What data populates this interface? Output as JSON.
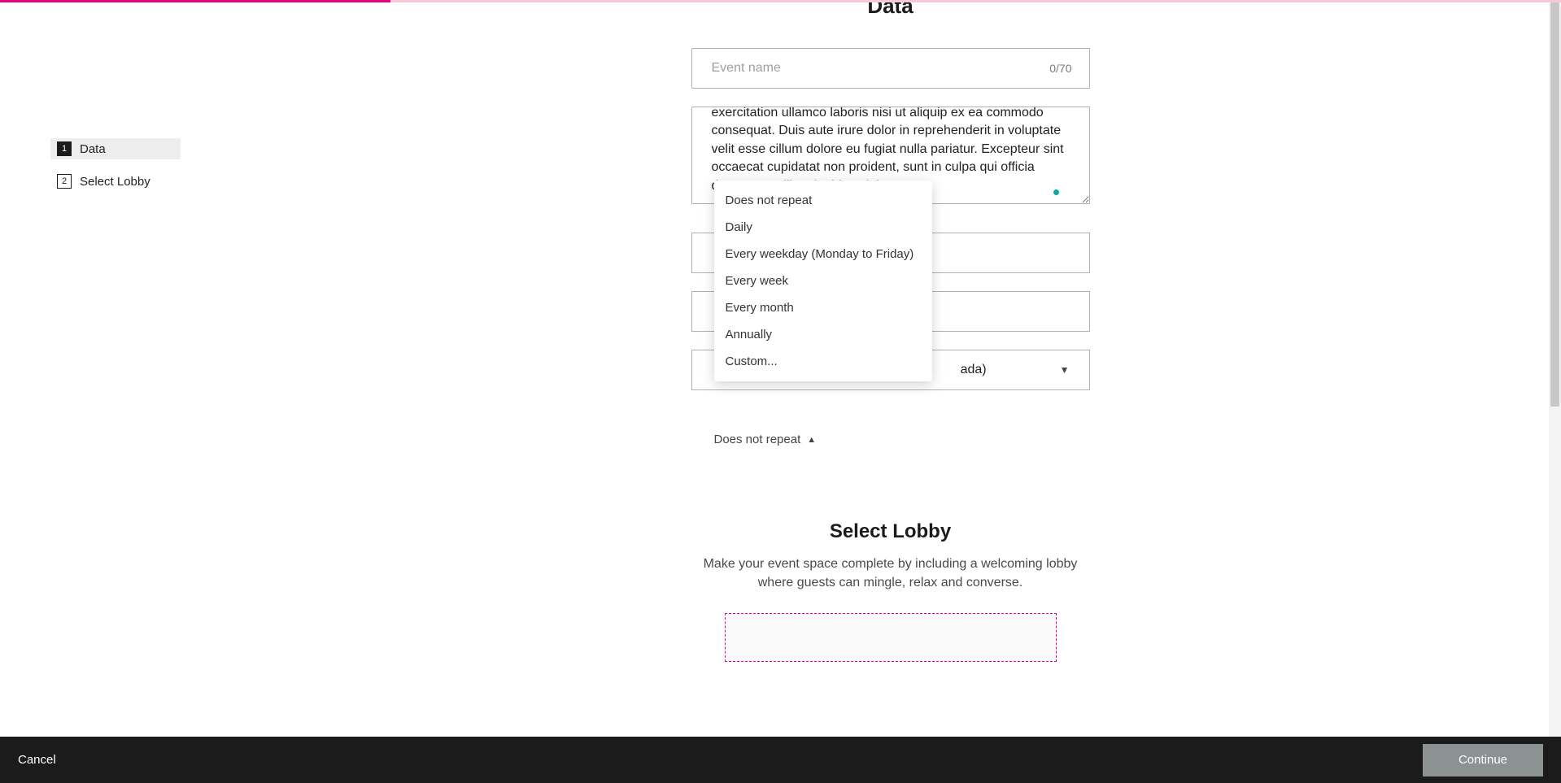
{
  "progress": {
    "percent": 25
  },
  "sidebar": {
    "steps": [
      {
        "num": "1",
        "label": "Data",
        "active": true
      },
      {
        "num": "2",
        "label": "Select Lobby",
        "active": false
      }
    ]
  },
  "form": {
    "title": "Data",
    "event_name_placeholder": "Event name",
    "event_name_value": "",
    "char_count": "0/70",
    "description_value": "exercitation ullamco laboris nisi ut aliquip ex ea commodo consequat. Duis aute irure dolor in reprehenderit in voluptate velit esse cillum dolore eu fugiat nulla pariatur. Excepteur sint occaecat cupidatat non proident, sunt in culpa qui officia deserunt mollit anim id est laborum.",
    "field_hidden_1": "",
    "field_hidden_2": "",
    "timezone_display": "ada)",
    "repeat_label": "Does not repeat",
    "repeat_options": [
      "Does not repeat",
      "Daily",
      "Every weekday (Monday to Friday)",
      "Every week",
      "Every month",
      "Annually",
      "Custom..."
    ]
  },
  "lobby": {
    "title": "Select Lobby",
    "subtitle": "Make your event space complete by including a welcoming lobby where guests can mingle, relax and converse."
  },
  "footer": {
    "cancel": "Cancel",
    "continue": "Continue"
  }
}
